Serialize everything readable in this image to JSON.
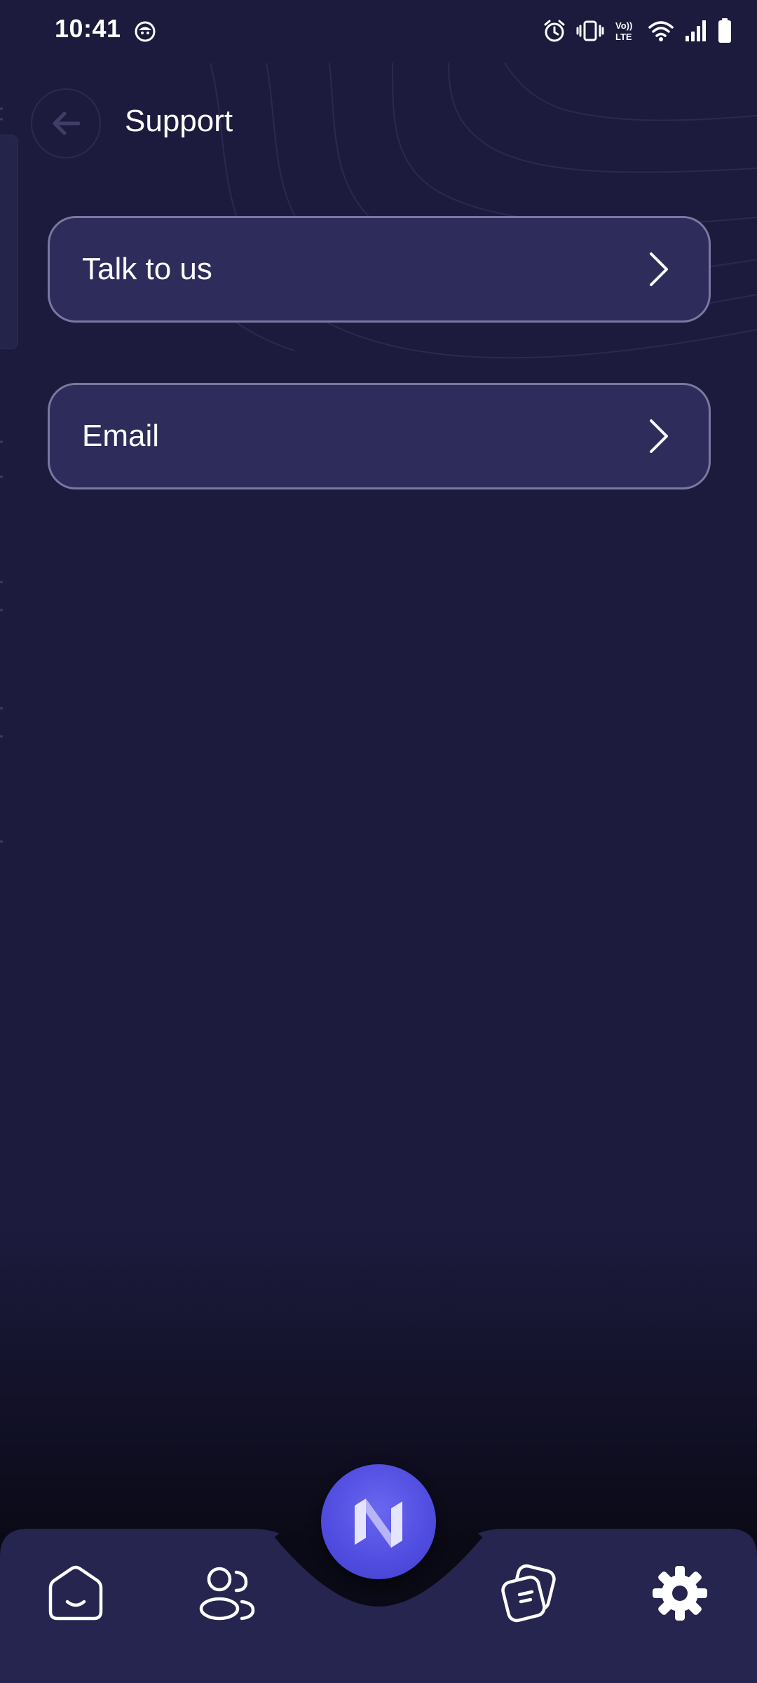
{
  "status_bar": {
    "time": "10:41",
    "icons": [
      "app-notification-icon",
      "alarm-icon",
      "vibrate-icon",
      "volte-icon",
      "wifi-icon",
      "signal-icon",
      "battery-icon"
    ]
  },
  "header": {
    "title": "Support",
    "back_icon": "arrow-left-icon"
  },
  "options": [
    {
      "label": "Talk to us",
      "icon": "chevron-right-icon"
    },
    {
      "label": "Email",
      "icon": "chevron-right-icon"
    }
  ],
  "bottom_nav": {
    "items": [
      {
        "icon": "home-icon",
        "active": false
      },
      {
        "icon": "people-icon",
        "active": false
      },
      {
        "icon": "brand-logo-n-icon",
        "active": false
      },
      {
        "icon": "notes-icon",
        "active": false
      },
      {
        "icon": "gear-icon",
        "active": true
      }
    ]
  },
  "colors": {
    "background": "#1c1b3d",
    "card_fill": "#2e2c5b",
    "card_border": "#7a78a0",
    "nav_bar": "#262550",
    "fab": "#5653e6",
    "text": "#ffffff"
  }
}
